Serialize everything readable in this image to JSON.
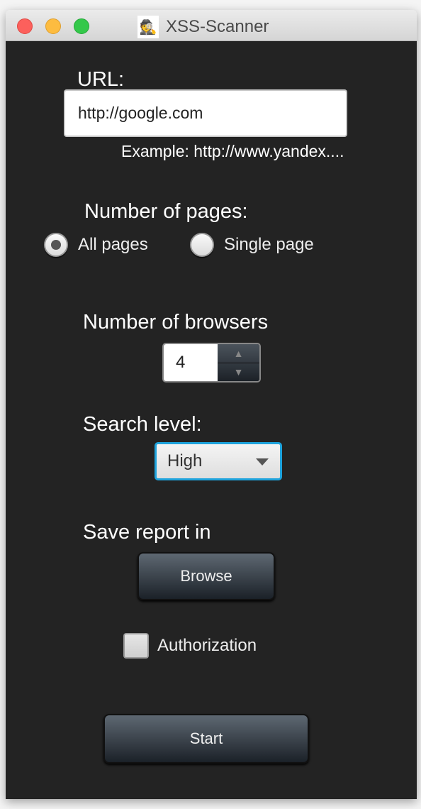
{
  "window": {
    "title": "XSS-Scanner",
    "app_icon": "detective-mascot-icon"
  },
  "url": {
    "label": "URL:",
    "value": "http://google.com",
    "hint": "Example: http://www.yandex...."
  },
  "pages": {
    "label": "Number of pages:",
    "options": [
      {
        "label": "All pages",
        "selected": true
      },
      {
        "label": "Single page",
        "selected": false
      }
    ]
  },
  "browsers": {
    "label": "Number of browsers",
    "value": "4"
  },
  "search_level": {
    "label": "Search level:",
    "selected": "High"
  },
  "report": {
    "label": "Save report in",
    "browse_label": "Browse"
  },
  "authorization": {
    "label": "Authorization",
    "checked": false
  },
  "start_label": "Start",
  "colors": {
    "background": "#232323",
    "focus": "#1ea3dc"
  }
}
